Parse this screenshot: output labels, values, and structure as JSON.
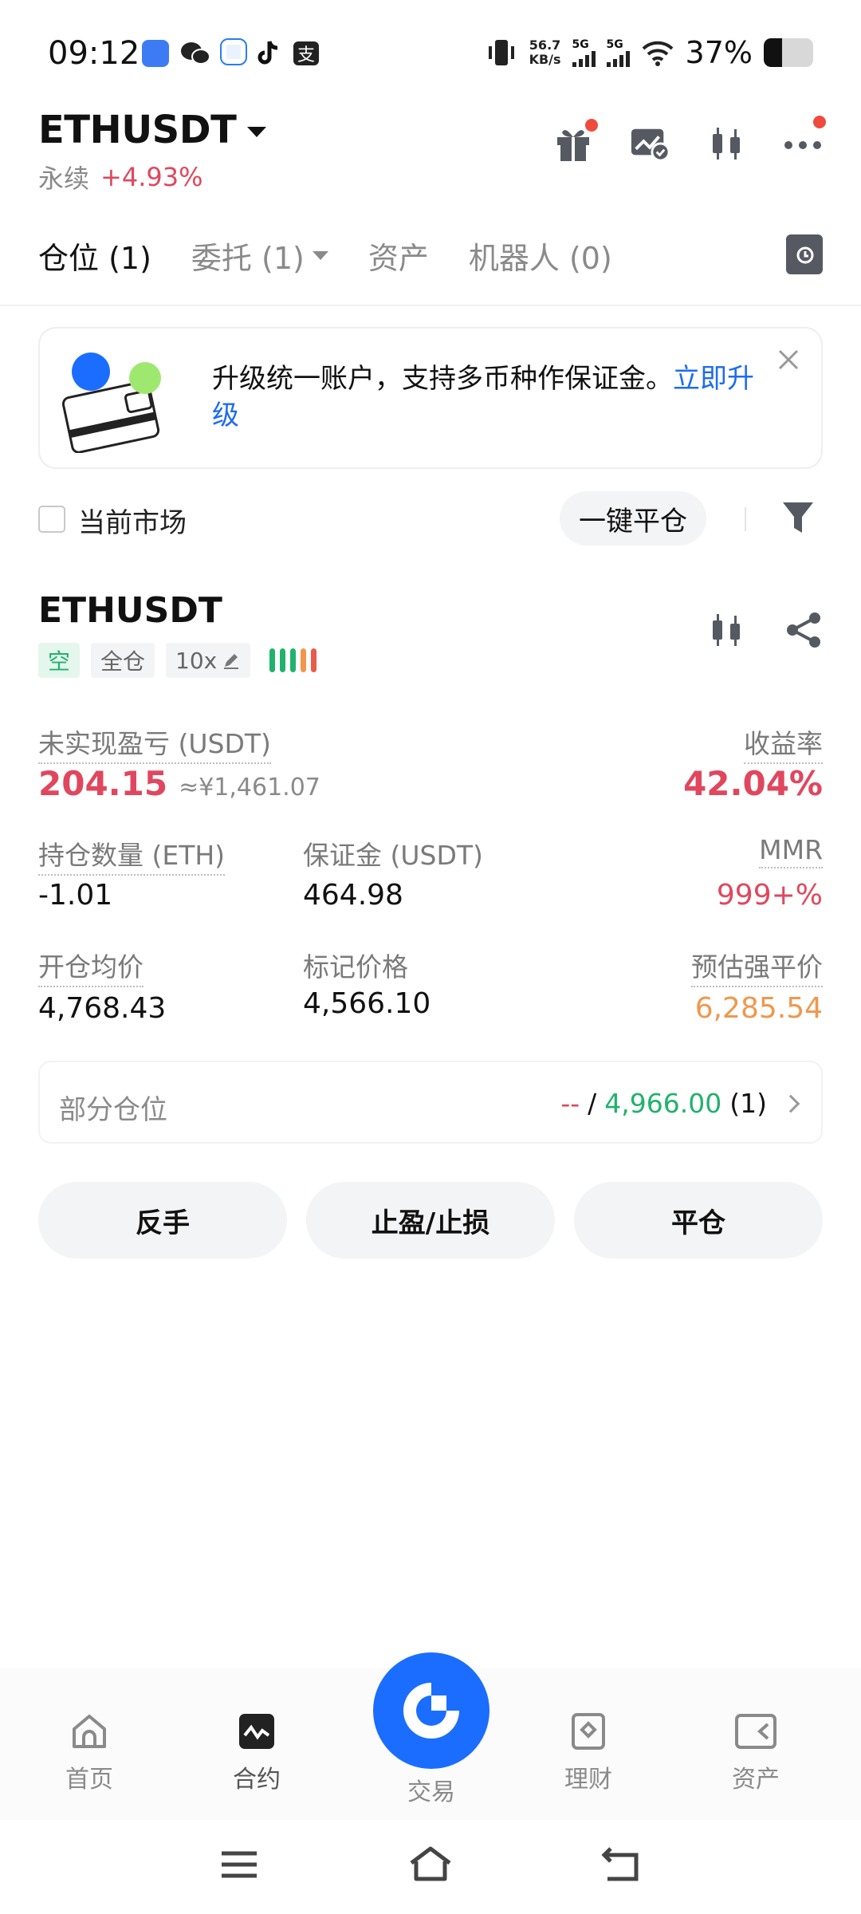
{
  "status_bar": {
    "time": "09:12",
    "net_speed_value": "56.7",
    "net_speed_unit": "KB/s",
    "sim1": "5G",
    "sim2": "5G",
    "battery_pct": "37%",
    "battery_level": 0.37
  },
  "header": {
    "symbol": "ETHUSDT",
    "contract_type": "永续",
    "change": "+4.93%",
    "icons": [
      "gift-icon",
      "chart-check-icon",
      "candlestick-icon",
      "more-icon"
    ]
  },
  "tabs": [
    {
      "label": "仓位 (1)",
      "active": true
    },
    {
      "label": "委托 (1)",
      "active": false,
      "dropdown": true
    },
    {
      "label": "资产",
      "active": false
    },
    {
      "label": "机器人 (0)",
      "active": false
    }
  ],
  "banner": {
    "text": "升级统一账户，支持多币种作保证金。",
    "link": "立即升级"
  },
  "filter": {
    "current_market_label": "当前市场",
    "close_all_label": "一键平仓"
  },
  "position": {
    "symbol": "ETHUSDT",
    "side_tag": "空",
    "margin_mode_tag": "全仓",
    "leverage_tag": "10x",
    "unrealized_pnl_label": "未实现盈亏 (USDT)",
    "unrealized_pnl_value": "204.15",
    "unrealized_pnl_cny": "≈¥1,461.07",
    "roe_label": "收益率",
    "roe_value": "42.04%",
    "size_label": "持仓数量 (ETH)",
    "size_value": "-1.01",
    "margin_label": "保证金 (USDT)",
    "margin_value": "464.98",
    "mmr_label": "MMR",
    "mmr_value": "999+%",
    "entry_label": "开仓均价",
    "entry_value": "4,768.43",
    "mark_label": "标记价格",
    "mark_value": "4,566.10",
    "liq_label": "预估强平价",
    "liq_value": "6,285.54",
    "partial_label": "部分仓位",
    "partial_dash": "--",
    "partial_sep": "/",
    "partial_value": "4,966.00",
    "partial_count": "(1)"
  },
  "actions": {
    "reverse": "反手",
    "tpsl": "止盈/止损",
    "close": "平仓"
  },
  "bottom_nav": {
    "home": "首页",
    "contract": "合约",
    "trade": "交易",
    "finance": "理财",
    "assets": "资产"
  },
  "colors": {
    "accent_blue": "#1a6dff",
    "up_red": "#e0475e",
    "down_green": "#20b26c",
    "warn_orange": "#f0974d"
  }
}
